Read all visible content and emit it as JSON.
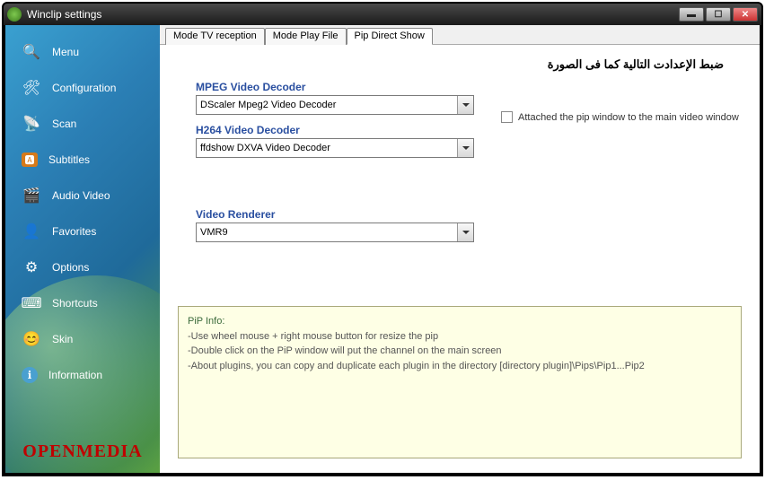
{
  "window": {
    "title": "Winclip settings"
  },
  "sidebar": {
    "items": [
      {
        "label": "Menu",
        "icon": "🔍"
      },
      {
        "label": "Configuration",
        "icon": "🛠"
      },
      {
        "label": "Scan",
        "icon": "📡"
      },
      {
        "label": "Subtitles",
        "icon": "🅰"
      },
      {
        "label": "Audio Video",
        "icon": "🎬"
      },
      {
        "label": "Favorites",
        "icon": "👤"
      },
      {
        "label": "Options",
        "icon": "⚙"
      },
      {
        "label": "Shortcuts",
        "icon": "⌨"
      },
      {
        "label": "Skin",
        "icon": "😊"
      },
      {
        "label": "Information",
        "icon": "ℹ"
      }
    ],
    "brand": "OPENMEDIA"
  },
  "tabs": {
    "items": [
      {
        "label": "Mode TV reception"
      },
      {
        "label": "Mode Play File"
      },
      {
        "label": "Pip Direct Show"
      }
    ],
    "active": 2
  },
  "form": {
    "instruction": "ضبط الإعدادت التالية كما فى الصورة",
    "mpeg_label": "MPEG Video Decoder",
    "mpeg_value": "DScaler Mpeg2 Video Decoder",
    "h264_label": "H264 Video Decoder",
    "h264_value": "ffdshow DXVA Video Decoder",
    "renderer_label": "Video Renderer",
    "renderer_value": "VMR9",
    "attach_label": "Attached the pip window to the main video window"
  },
  "info": {
    "title": "PiP Info:",
    "line1": "-Use wheel mouse + right mouse button for resize the pip",
    "line2": "-Double click on the PiP window will put the channel on the main screen",
    "line3": "-About plugins, you can copy and duplicate each plugin in the directory [directory plugin]\\Pips\\Pip1...Pip2"
  }
}
